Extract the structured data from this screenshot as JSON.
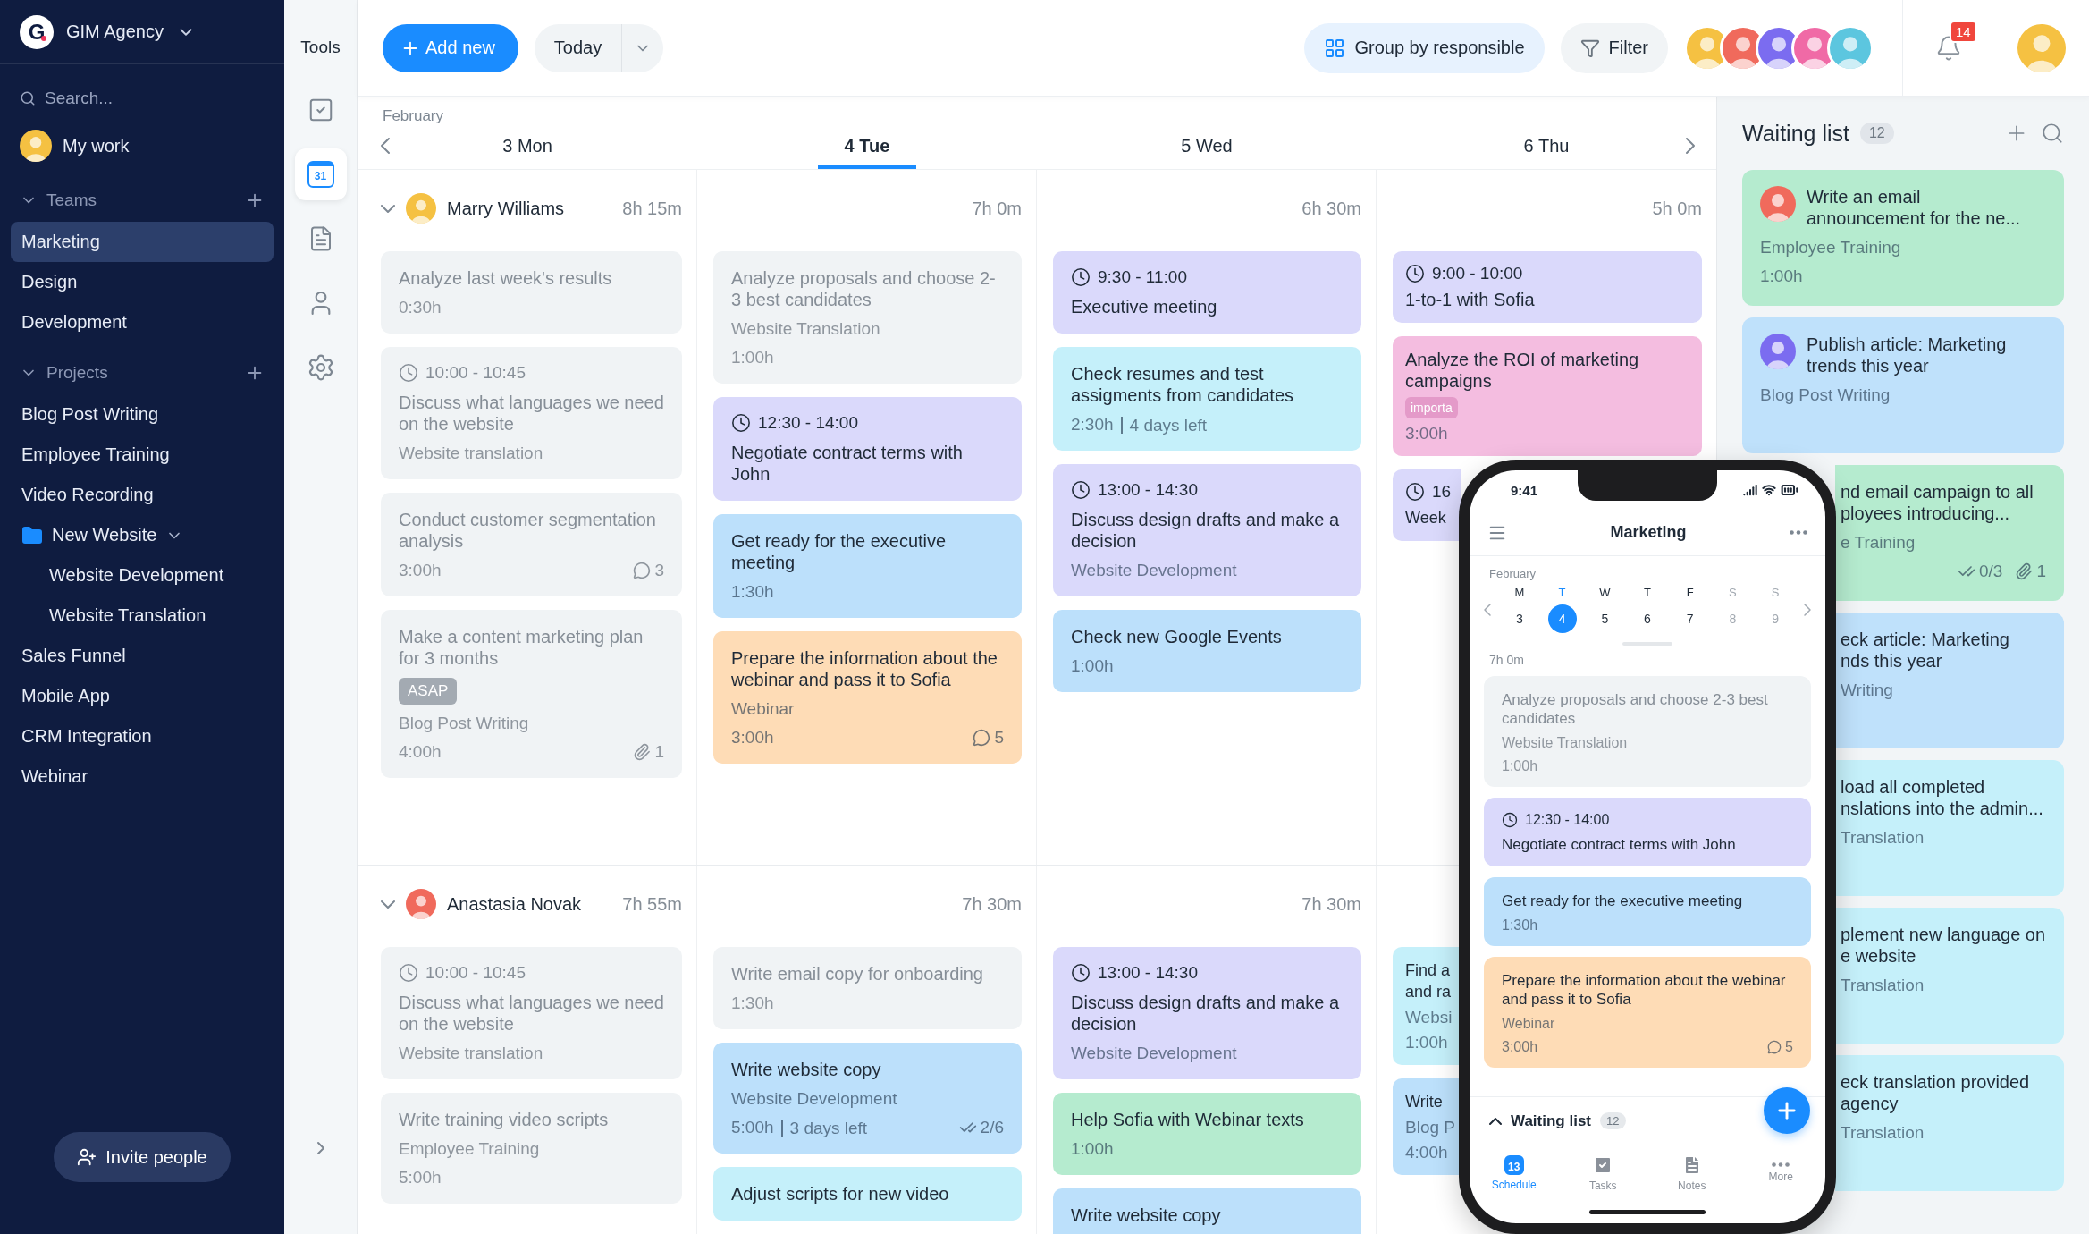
{
  "sidebar": {
    "logo": "G",
    "workspace": "GIM Agency",
    "search": {
      "placeholder": "Search..."
    },
    "my_work": {
      "label": "My work"
    },
    "teams": {
      "title": "Teams",
      "expanded": true,
      "items": [
        {
          "label": "Marketing",
          "selected": true
        },
        {
          "label": "Design",
          "selected": false
        },
        {
          "label": "Development",
          "selected": false
        }
      ]
    },
    "projects": {
      "title": "Projects",
      "expanded": true,
      "items": [
        {
          "label": "Blog Post Writing",
          "kind": "project",
          "selected": false
        },
        {
          "label": "Employee Training",
          "kind": "project",
          "selected": false
        },
        {
          "label": "Video Recording",
          "kind": "project",
          "selected": false
        },
        {
          "label": "New Website",
          "kind": "folder",
          "selected": false,
          "expanded": true,
          "children": [
            {
              "label": "Website Development",
              "selected": false
            },
            {
              "label": "Website Translation",
              "selected": false
            }
          ]
        },
        {
          "label": "Sales Funnel",
          "kind": "project",
          "selected": false
        },
        {
          "label": "Mobile App",
          "kind": "project",
          "selected": false
        },
        {
          "label": "CRM Integration",
          "kind": "project",
          "selected": false
        },
        {
          "label": "Webinar",
          "kind": "project",
          "selected": false
        }
      ]
    },
    "invite": "Invite people"
  },
  "tools": {
    "title": "Tools",
    "items": [
      {
        "kind": "tasks",
        "selected": false
      },
      {
        "kind": "calendar",
        "date": "31",
        "selected": true
      },
      {
        "kind": "notes",
        "selected": false
      },
      {
        "kind": "people",
        "selected": false
      },
      {
        "kind": "settings",
        "selected": false
      }
    ]
  },
  "toolbar": {
    "add_new": "Add new",
    "today": "Today",
    "group": "Group by responsible",
    "filter": "Filter",
    "team": [
      {
        "color": "#f5c142"
      },
      {
        "color": "#f06a5c"
      },
      {
        "color": "#7b6cf0"
      },
      {
        "color": "#f06aa6"
      },
      {
        "color": "#5cc6df"
      }
    ],
    "notifications": "14"
  },
  "calendar": {
    "month": "February",
    "days": [
      {
        "label": "3 Mon",
        "selected": false
      },
      {
        "label": "4 Tue",
        "selected": true
      },
      {
        "label": "5 Wed",
        "selected": false
      },
      {
        "label": "6 Thu",
        "selected": false
      }
    ],
    "rows": [
      {
        "person": "Marry Williams",
        "expanded": true,
        "cells": [
          {
            "total": "8h 15m",
            "cards": [
              {
                "color": "#f0f3f5",
                "done": true,
                "title": "Analyze last week's results",
                "duration": "0:30h"
              },
              {
                "color": "#f0f3f5",
                "done": true,
                "time": "10:00 - 10:45",
                "title": "Discuss what languages we need on the website",
                "project": "Website translation"
              },
              {
                "color": "#f0f3f5",
                "done": true,
                "title": "Conduct customer segmentation analysis",
                "duration": "3:00h",
                "comments": "3"
              },
              {
                "color": "#f0f3f5",
                "done": true,
                "title": "Make a content marketing plan for 3 months",
                "tag": {
                  "label": "ASAP",
                  "color": "#a3aab2"
                },
                "project": "Blog Post Writing",
                "duration": "4:00h",
                "attachments": "1"
              }
            ]
          },
          {
            "total": "7h 0m",
            "cards": [
              {
                "color": "#f0f3f5",
                "done": true,
                "title": "Analyze proposals and choose 2-3 best candidates",
                "project": "Website Translation",
                "duration": "1:00h"
              },
              {
                "color": "#dad9fb",
                "done": false,
                "time": "12:30 - 14:00",
                "title": "Negotiate contract terms with John"
              },
              {
                "color": "#bce0fb",
                "done": false,
                "title": "Get ready for the executive meeting",
                "duration": "1:30h"
              },
              {
                "color": "#fedcb6",
                "done": false,
                "title": "Prepare the information about the webinar and pass it to Sofia",
                "project": "Webinar",
                "duration": "3:00h",
                "comments": "5"
              }
            ]
          },
          {
            "total": "6h 30m",
            "cards": [
              {
                "color": "#dad9fb",
                "done": false,
                "time": "9:30 - 11:00",
                "title": "Executive meeting"
              },
              {
                "color": "#c5f0fa",
                "done": false,
                "title": "Check resumes and test assigments from candidates",
                "duration": "2:30h",
                "days_left": "4 days left"
              },
              {
                "color": "#dad9fb",
                "done": false,
                "time": "13:00 - 14:30",
                "title": "Discuss design drafts and make a decision",
                "project": "Website Development"
              },
              {
                "color": "#bce0fb",
                "done": false,
                "title": "Check new Google Events",
                "duration": "1:00h"
              }
            ]
          },
          {
            "total": "5h 0m",
            "cards": [
              {
                "color": "#dad9fb",
                "done": false,
                "time": "9:00 - 10:00",
                "title": "1-to-1 with Sofia"
              },
              {
                "color": "#f4bde0",
                "done": false,
                "title": "Analyze the ROI of marketing campaigns",
                "tag": {
                  "label": "importa",
                  "color": "#e49ac9"
                },
                "duration": "3:00h"
              },
              {
                "color": "#dad9fb",
                "done": false,
                "time": "16",
                "title": "Week"
              }
            ]
          }
        ]
      },
      {
        "person": "Anastasia Novak",
        "expanded": true,
        "cells": [
          {
            "total": "7h 55m",
            "cards": [
              {
                "color": "#f0f3f5",
                "done": true,
                "time": "10:00 - 10:45",
                "title": "Discuss what languages we need on the website",
                "project": "Website translation"
              },
              {
                "color": "#f0f3f5",
                "done": true,
                "title": "Write training video scripts",
                "project": "Employee Training",
                "duration": "5:00h"
              }
            ]
          },
          {
            "total": "7h 30m",
            "cards": [
              {
                "color": "#f0f3f5",
                "done": true,
                "title": "Write email copy for onboarding",
                "duration": "1:30h"
              },
              {
                "color": "#bce0fb",
                "done": false,
                "title": "Write website copy",
                "project": "Website Development",
                "duration": "5:00h",
                "days_left": "3 days left",
                "checklist": "2/6"
              },
              {
                "color": "#c5f0fa",
                "done": false,
                "title": "Adjust scripts for new video"
              }
            ]
          },
          {
            "total": "7h 30m",
            "cards": [
              {
                "color": "#dad9fb",
                "done": false,
                "time": "13:00 - 14:30",
                "title": "Discuss design drafts and make a decision",
                "project": "Website Development"
              },
              {
                "color": "#b5ebcf",
                "done": false,
                "title": "Help Sofia with Webinar texts",
                "duration": "1:00h"
              },
              {
                "color": "#bce0fb",
                "done": false,
                "title": "Write website copy"
              }
            ]
          },
          {
            "cards": [
              {
                "color": "#c5f0fa",
                "done": false,
                "title": "Find a\nand ra",
                "project": "Websi",
                "duration": "1:00h"
              },
              {
                "color": "#bce0fb",
                "done": false,
                "title": "Write",
                "project": "Blog P",
                "duration": "4:00h"
              }
            ]
          }
        ]
      }
    ]
  },
  "waiting_list": {
    "title": "Waiting list",
    "count": "12",
    "cards": [
      {
        "color": "#b5ebcf",
        "avatar": true,
        "title": "Write an email\nannouncement for the ne...",
        "project": "Employee Training",
        "duration": "1:00h"
      },
      {
        "color": "#bfe1fb",
        "avatar": true,
        "title": "Publish article: Marketing\ntrends this year",
        "project": "Blog Post Writing"
      },
      {
        "color": "#b5ebcf",
        "title": "nd email campaign to all\nployees introducing...",
        "project": "e Training",
        "checklist": "0/3",
        "attachments": "1"
      },
      {
        "color": "#bfe1fb",
        "title": "eck article: Marketing\nnds this year",
        "project": "Writing"
      },
      {
        "color": "#c5f0fa",
        "title": "load all completed\nnslations into the admin...",
        "project": "Translation"
      },
      {
        "color": "#c5f0fa",
        "title": "plement new language on\ne website",
        "project": "Translation"
      },
      {
        "color": "#c5f0fa",
        "title": "eck translation provided\n agency",
        "project": "Translation"
      }
    ]
  },
  "phone": {
    "time": "9:41",
    "title": "Marketing",
    "month": "February",
    "days": [
      {
        "letter": "M",
        "number": "3",
        "selected": false,
        "weekend": false
      },
      {
        "letter": "T",
        "number": "4",
        "selected": true,
        "weekend": false
      },
      {
        "letter": "W",
        "number": "5",
        "selected": false,
        "weekend": false
      },
      {
        "letter": "T",
        "number": "6",
        "selected": false,
        "weekend": false
      },
      {
        "letter": "F",
        "number": "7",
        "selected": false,
        "weekend": false
      },
      {
        "letter": "S",
        "number": "8",
        "selected": false,
        "weekend": true
      },
      {
        "letter": "S",
        "number": "9",
        "selected": false,
        "weekend": true
      }
    ],
    "total": "7h 0m",
    "cards": [
      {
        "color": "#f0f3f5",
        "done": true,
        "title": "Analyze proposals and choose 2-3 best candidates",
        "project": "Website Translation",
        "duration": "1:00h"
      },
      {
        "color": "#dad9fb",
        "done": false,
        "time": "12:30 - 14:00",
        "title": "Negotiate contract terms with John"
      },
      {
        "color": "#bce0fb",
        "done": false,
        "title": "Get ready for the executive meeting",
        "duration": "1:30h"
      },
      {
        "color": "#fedcb6",
        "done": false,
        "title": "Prepare the information about the webinar and pass it to Sofia",
        "project": "Webinar",
        "duration": "3:00h",
        "comments": "5"
      }
    ],
    "waiting": {
      "label": "Waiting list",
      "count": "12"
    },
    "tabs": [
      {
        "kind": "schedule",
        "label": "Schedule",
        "date": "13",
        "selected": true
      },
      {
        "kind": "tasks",
        "label": "Tasks",
        "selected": false
      },
      {
        "kind": "notes",
        "label": "Notes",
        "selected": false
      },
      {
        "kind": "more",
        "label": "More",
        "selected": false
      }
    ]
  }
}
